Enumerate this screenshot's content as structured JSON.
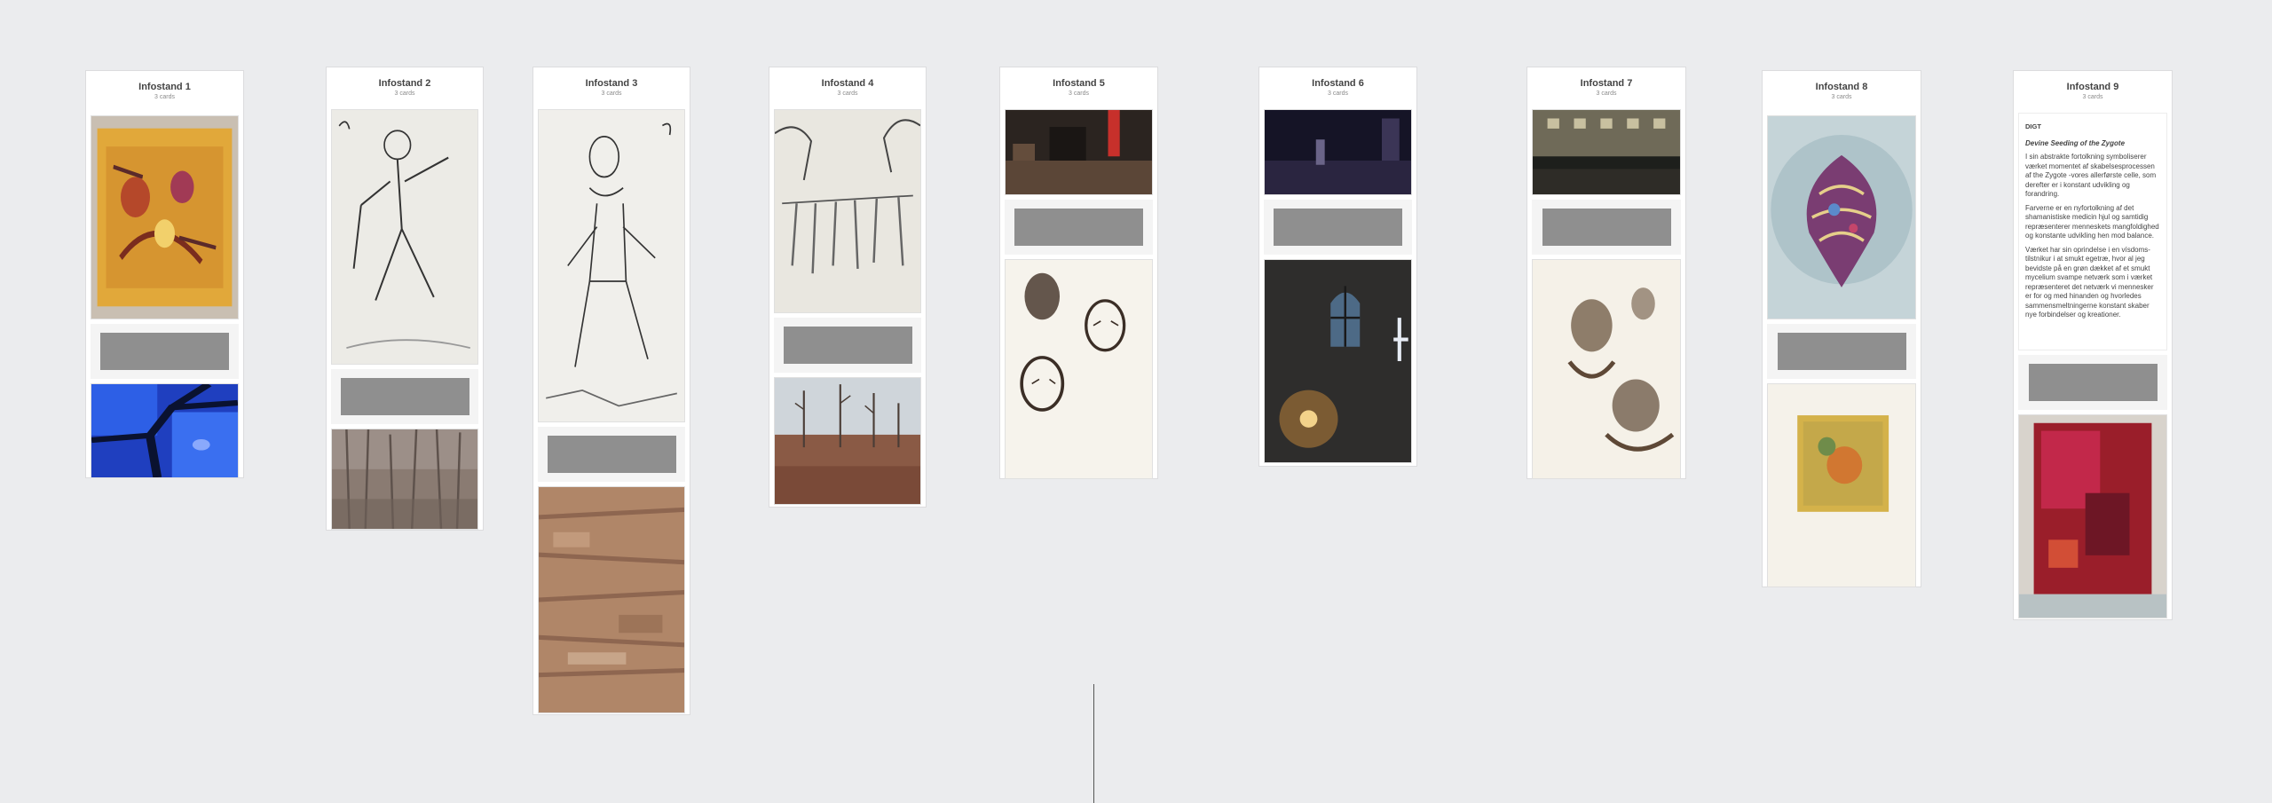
{
  "columns": [
    {
      "title": "Infostand 1",
      "subtitle": "3 cards",
      "cards": [
        {
          "kind": "image",
          "icon": "abstract-yellow-painting"
        },
        {
          "kind": "placeholder"
        },
        {
          "kind": "image",
          "icon": "blue-stained-glass"
        }
      ]
    },
    {
      "title": "Infostand 2",
      "subtitle": "3 cards",
      "cards": [
        {
          "kind": "image",
          "icon": "sketch-dancing-man"
        },
        {
          "kind": "placeholder"
        },
        {
          "kind": "image",
          "icon": "bare-forest-photo"
        }
      ]
    },
    {
      "title": "Infostand 3",
      "subtitle": "3 cards",
      "cards": [
        {
          "kind": "image",
          "icon": "sketch-sitting-woman"
        },
        {
          "kind": "placeholder"
        },
        {
          "kind": "image",
          "icon": "burnt-terrain-photo"
        }
      ]
    },
    {
      "title": "Infostand 4",
      "subtitle": "3 cards",
      "cards": [
        {
          "kind": "image",
          "icon": "sketch-elephants-fish"
        },
        {
          "kind": "placeholder"
        },
        {
          "kind": "image",
          "icon": "burnt-trees-landscape"
        }
      ]
    },
    {
      "title": "Infostand 5",
      "subtitle": "3 cards",
      "cards": [
        {
          "kind": "image",
          "icon": "dark-interior-photo"
        },
        {
          "kind": "placeholder"
        },
        {
          "kind": "image",
          "icon": "sketch-faces"
        }
      ]
    },
    {
      "title": "Infostand 6",
      "subtitle": "3 cards",
      "cards": [
        {
          "kind": "image",
          "icon": "dark-room-photo"
        },
        {
          "kind": "placeholder"
        },
        {
          "kind": "image",
          "icon": "night-building-window"
        }
      ]
    },
    {
      "title": "Infostand 7",
      "subtitle": "3 cards",
      "cards": [
        {
          "kind": "image",
          "icon": "night-street-photo"
        },
        {
          "kind": "placeholder"
        },
        {
          "kind": "image",
          "icon": "sketch-figures"
        }
      ]
    },
    {
      "title": "Infostand 8",
      "subtitle": "3 cards",
      "cards": [
        {
          "kind": "image",
          "icon": "glass-ornament-painting"
        },
        {
          "kind": "placeholder"
        },
        {
          "kind": "image",
          "icon": "yellow-small-painting"
        }
      ]
    },
    {
      "title": "Infostand 9",
      "subtitle": "3 cards",
      "cards": [
        {
          "kind": "text",
          "heading": "DIGT",
          "title": "Devine Seeding of the Zygote",
          "paragraphs": [
            "I sin abstrakte fortolkning symboliserer værket momentet af skabelsesprocessen af the Zygote -vores allerførste celle, som derefter er i konstant udvikling og forandring.",
            "Farverne er en nyfortolkning af det shamanistiske medicin hjul og samtidig repræsenterer menneskets mangfoldighed og konstante udvikling hen mod balance.",
            "Værket har sin oprindelse i en vísdoms-tilstnikur i at smukt egetræ, hvor al jeg bevidste på en grøn dækket af et smukt mycelium svampe netværk som i værket repræsenteret det netværk vi mennesker er for og med hinanden og hvorledes sammensmeltningerne konstant skaber nye forbindelser og kreationer."
          ]
        },
        {
          "kind": "placeholder"
        },
        {
          "kind": "image",
          "icon": "red-abstract-painting"
        }
      ]
    }
  ]
}
